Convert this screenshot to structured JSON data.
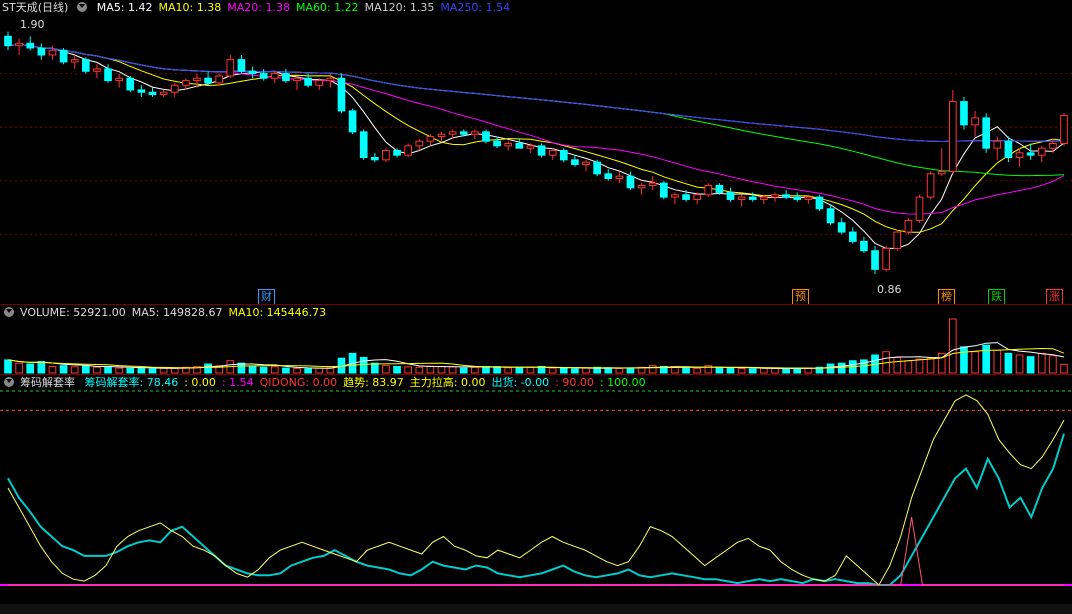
{
  "colors": {
    "ma5": "#ffffff",
    "ma10": "#ffff00",
    "ma20": "#ff00ff",
    "ma60": "#00ff00",
    "ma120": "#cccccc",
    "ma250": "#3344ff",
    "up": "#ff3333",
    "down": "#00ffff",
    "grid": "#7a0000"
  },
  "price_panel": {
    "title": "ST天成(日线)",
    "ma_labels": [
      {
        "name": "MA5",
        "value": "1.42",
        "color": "#ffffff"
      },
      {
        "name": "MA10",
        "value": "1.38",
        "color": "#ffff00"
      },
      {
        "name": "MA20",
        "value": "1.38",
        "color": "#ff00ff"
      },
      {
        "name": "MA60",
        "value": "1.22",
        "color": "#00ff00"
      },
      {
        "name": "MA120",
        "value": "1.35",
        "color": "#cccccc"
      },
      {
        "name": "MA250",
        "value": "1.54",
        "color": "#3344ff"
      }
    ],
    "high_label": "1.90",
    "low_label": "0.86",
    "tags": [
      {
        "text": "财",
        "color": "#3399ff"
      },
      {
        "text": "预",
        "color": "#ff8800"
      },
      {
        "text": "榜",
        "color": "#ff8800"
      },
      {
        "text": "跌",
        "color": "#00cc00"
      },
      {
        "text": "涨",
        "color": "#ff3333"
      }
    ]
  },
  "volume_panel": {
    "labels": [
      {
        "name": "VOLUME",
        "value": "52921.00",
        "color": "#dddddd"
      },
      {
        "name": "MA5",
        "value": "149828.67",
        "color": "#dddddd"
      },
      {
        "name": "MA10",
        "value": "145446.73",
        "color": "#ffff00"
      }
    ]
  },
  "indicator_panel": {
    "title": "筹码解套率",
    "labels": [
      {
        "text": "筹码解套率: 78.46",
        "color": "#00ffff"
      },
      {
        "text": ": 0.00",
        "color": "#ffff00"
      },
      {
        "text": ": 1.54",
        "color": "#ff00ff"
      },
      {
        "text": "QIDONG: 0.00",
        "color": "#ff3333"
      },
      {
        "text": "趋势: 83.97",
        "color": "#ffff00"
      },
      {
        "text": "主力拉高: 0.00",
        "color": "#ffff00"
      },
      {
        "text": "出货: -0.00",
        "color": "#00ffff"
      },
      {
        "text": ": 90.00",
        "color": "#ff3333"
      },
      {
        "text": ": 100.00",
        "color": "#00ff00"
      }
    ]
  },
  "chart_data": [
    {
      "type": "candlestick",
      "ylim": [
        0.8,
        1.95
      ],
      "ohlc": [
        [
          1.88,
          1.9,
          1.82,
          1.84
        ],
        [
          1.84,
          1.87,
          1.8,
          1.85
        ],
        [
          1.85,
          1.88,
          1.82,
          1.83
        ],
        [
          1.83,
          1.85,
          1.78,
          1.8
        ],
        [
          1.8,
          1.84,
          1.78,
          1.82
        ],
        [
          1.82,
          1.83,
          1.76,
          1.77
        ],
        [
          1.77,
          1.8,
          1.74,
          1.78
        ],
        [
          1.78,
          1.79,
          1.72,
          1.73
        ],
        [
          1.73,
          1.76,
          1.7,
          1.74
        ],
        [
          1.74,
          1.76,
          1.68,
          1.69
        ],
        [
          1.69,
          1.72,
          1.66,
          1.7
        ],
        [
          1.7,
          1.71,
          1.64,
          1.65
        ],
        [
          1.65,
          1.67,
          1.62,
          1.64
        ],
        [
          1.64,
          1.66,
          1.62,
          1.63
        ],
        [
          1.63,
          1.65,
          1.62,
          1.64
        ],
        [
          1.64,
          1.68,
          1.62,
          1.67
        ],
        [
          1.67,
          1.7,
          1.65,
          1.69
        ],
        [
          1.69,
          1.72,
          1.66,
          1.7
        ],
        [
          1.7,
          1.73,
          1.67,
          1.68
        ],
        [
          1.68,
          1.72,
          1.67,
          1.71
        ],
        [
          1.71,
          1.8,
          1.7,
          1.78
        ],
        [
          1.78,
          1.8,
          1.72,
          1.73
        ],
        [
          1.73,
          1.75,
          1.7,
          1.72
        ],
        [
          1.72,
          1.74,
          1.69,
          1.7
        ],
        [
          1.7,
          1.73,
          1.68,
          1.72
        ],
        [
          1.72,
          1.74,
          1.68,
          1.69
        ],
        [
          1.69,
          1.71,
          1.65,
          1.7
        ],
        [
          1.7,
          1.72,
          1.66,
          1.67
        ],
        [
          1.67,
          1.7,
          1.65,
          1.69
        ],
        [
          1.69,
          1.72,
          1.66,
          1.7
        ],
        [
          1.7,
          1.72,
          1.55,
          1.56
        ],
        [
          1.56,
          1.57,
          1.46,
          1.47
        ],
        [
          1.47,
          1.48,
          1.35,
          1.36
        ],
        [
          1.36,
          1.38,
          1.34,
          1.35
        ],
        [
          1.35,
          1.4,
          1.34,
          1.39
        ],
        [
          1.39,
          1.4,
          1.36,
          1.37
        ],
        [
          1.37,
          1.42,
          1.36,
          1.41
        ],
        [
          1.41,
          1.44,
          1.39,
          1.43
        ],
        [
          1.43,
          1.46,
          1.41,
          1.45
        ],
        [
          1.45,
          1.47,
          1.43,
          1.46
        ],
        [
          1.46,
          1.48,
          1.44,
          1.47
        ],
        [
          1.47,
          1.48,
          1.45,
          1.46
        ],
        [
          1.46,
          1.48,
          1.44,
          1.47
        ],
        [
          1.47,
          1.48,
          1.42,
          1.43
        ],
        [
          1.43,
          1.45,
          1.4,
          1.41
        ],
        [
          1.41,
          1.43,
          1.39,
          1.42
        ],
        [
          1.42,
          1.44,
          1.4,
          1.4
        ],
        [
          1.4,
          1.42,
          1.38,
          1.41
        ],
        [
          1.41,
          1.42,
          1.36,
          1.37
        ],
        [
          1.37,
          1.4,
          1.35,
          1.39
        ],
        [
          1.39,
          1.4,
          1.34,
          1.35
        ],
        [
          1.35,
          1.37,
          1.32,
          1.33
        ],
        [
          1.33,
          1.35,
          1.3,
          1.34
        ],
        [
          1.34,
          1.35,
          1.28,
          1.29
        ],
        [
          1.29,
          1.31,
          1.26,
          1.27
        ],
        [
          1.27,
          1.3,
          1.25,
          1.28
        ],
        [
          1.28,
          1.3,
          1.22,
          1.23
        ],
        [
          1.23,
          1.25,
          1.2,
          1.24
        ],
        [
          1.24,
          1.28,
          1.22,
          1.25
        ],
        [
          1.25,
          1.26,
          1.18,
          1.19
        ],
        [
          1.19,
          1.21,
          1.16,
          1.2
        ],
        [
          1.2,
          1.22,
          1.17,
          1.18
        ],
        [
          1.18,
          1.21,
          1.16,
          1.2
        ],
        [
          1.2,
          1.25,
          1.19,
          1.24
        ],
        [
          1.24,
          1.25,
          1.2,
          1.21
        ],
        [
          1.21,
          1.23,
          1.17,
          1.18
        ],
        [
          1.18,
          1.2,
          1.15,
          1.19
        ],
        [
          1.19,
          1.21,
          1.17,
          1.18
        ],
        [
          1.18,
          1.2,
          1.16,
          1.19
        ],
        [
          1.19,
          1.21,
          1.17,
          1.2
        ],
        [
          1.2,
          1.22,
          1.18,
          1.19
        ],
        [
          1.19,
          1.21,
          1.17,
          1.18
        ],
        [
          1.18,
          1.2,
          1.16,
          1.19
        ],
        [
          1.19,
          1.2,
          1.13,
          1.14
        ],
        [
          1.14,
          1.16,
          1.07,
          1.08
        ],
        [
          1.08,
          1.1,
          1.03,
          1.04
        ],
        [
          1.04,
          1.06,
          0.99,
          1.0
        ],
        [
          1.0,
          1.02,
          0.95,
          0.96
        ],
        [
          0.96,
          0.98,
          0.86,
          0.88
        ],
        [
          0.88,
          0.98,
          0.87,
          0.97
        ],
        [
          0.97,
          1.05,
          0.96,
          1.04
        ],
        [
          1.04,
          1.1,
          1.03,
          1.09
        ],
        [
          1.09,
          1.2,
          1.08,
          1.19
        ],
        [
          1.19,
          1.3,
          1.18,
          1.29
        ],
        [
          1.29,
          1.4,
          1.28,
          1.3
        ],
        [
          1.3,
          1.65,
          1.29,
          1.6
        ],
        [
          1.6,
          1.62,
          1.48,
          1.5
        ],
        [
          1.5,
          1.56,
          1.45,
          1.53
        ],
        [
          1.53,
          1.55,
          1.38,
          1.4
        ],
        [
          1.4,
          1.45,
          1.35,
          1.43
        ],
        [
          1.43,
          1.45,
          1.34,
          1.36
        ],
        [
          1.36,
          1.4,
          1.32,
          1.38
        ],
        [
          1.38,
          1.42,
          1.35,
          1.37
        ],
        [
          1.37,
          1.41,
          1.34,
          1.4
        ],
        [
          1.4,
          1.44,
          1.38,
          1.42
        ],
        [
          1.42,
          1.55,
          1.41,
          1.54
        ]
      ]
    },
    {
      "type": "bar",
      "title": "VOLUME",
      "values": [
        80,
        60,
        55,
        70,
        40,
        45,
        38,
        42,
        35,
        40,
        30,
        28,
        32,
        25,
        30,
        28,
        35,
        40,
        55,
        45,
        75,
        60,
        40,
        35,
        38,
        30,
        28,
        25,
        30,
        32,
        90,
        120,
        95,
        60,
        45,
        40,
        38,
        35,
        42,
        40,
        38,
        30,
        35,
        40,
        38,
        32,
        30,
        35,
        40,
        30,
        28,
        25,
        30,
        35,
        32,
        28,
        30,
        35,
        45,
        40,
        38,
        30,
        28,
        45,
        35,
        30,
        28,
        25,
        30,
        28,
        25,
        30,
        28,
        35,
        55,
        60,
        75,
        80,
        110,
        130,
        95,
        75,
        85,
        90,
        120,
        330,
        160,
        130,
        170,
        140,
        120,
        110,
        100,
        120,
        105,
        53
      ]
    },
    {
      "type": "line",
      "title": "筹码解套率",
      "ylim": [
        0,
        100
      ],
      "series": [
        {
          "name": "筹码解套率",
          "color": "#00cccc",
          "values": [
            55,
            45,
            38,
            30,
            25,
            20,
            18,
            15,
            15,
            15,
            17,
            20,
            22,
            23,
            22,
            28,
            30,
            25,
            20,
            15,
            10,
            8,
            6,
            5,
            5,
            6,
            10,
            12,
            14,
            15,
            18,
            15,
            12,
            10,
            9,
            8,
            6,
            5,
            8,
            12,
            10,
            9,
            8,
            10,
            9,
            6,
            5,
            4,
            5,
            6,
            8,
            10,
            7,
            5,
            4,
            5,
            6,
            8,
            5,
            4,
            5,
            6,
            5,
            4,
            3,
            3,
            2,
            1,
            2,
            3,
            2,
            3,
            2,
            1,
            3,
            2,
            3,
            2,
            1,
            1,
            0,
            0,
            5,
            15,
            25,
            35,
            45,
            55,
            60,
            50,
            65,
            55,
            40,
            45,
            35,
            50,
            60,
            78
          ]
        },
        {
          "name": "趋势",
          "color": "#ffff66",
          "values": [
            50,
            40,
            30,
            20,
            12,
            6,
            3,
            2,
            5,
            10,
            20,
            25,
            28,
            30,
            32,
            28,
            25,
            20,
            18,
            15,
            10,
            6,
            4,
            8,
            14,
            18,
            20,
            22,
            20,
            18,
            16,
            14,
            12,
            18,
            20,
            22,
            20,
            18,
            16,
            22,
            25,
            20,
            18,
            15,
            14,
            18,
            16,
            14,
            18,
            22,
            25,
            22,
            20,
            18,
            15,
            12,
            10,
            12,
            20,
            30,
            28,
            25,
            20,
            15,
            10,
            14,
            18,
            22,
            24,
            20,
            18,
            12,
            8,
            5,
            3,
            2,
            5,
            15,
            10,
            5,
            0,
            10,
            25,
            45,
            60,
            75,
            85,
            95,
            98,
            95,
            88,
            75,
            68,
            62,
            60,
            66,
            75,
            85
          ]
        },
        {
          "name": "主力拉高",
          "color": "#ff5577",
          "values": [
            0,
            0,
            0,
            0,
            0,
            0,
            0,
            0,
            0,
            0,
            0,
            0,
            0,
            0,
            0,
            0,
            0,
            0,
            0,
            0,
            0,
            0,
            0,
            0,
            0,
            0,
            0,
            0,
            0,
            0,
            0,
            0,
            0,
            0,
            0,
            0,
            0,
            0,
            0,
            0,
            0,
            0,
            0,
            0,
            0,
            0,
            0,
            0,
            0,
            0,
            0,
            0,
            0,
            0,
            0,
            0,
            0,
            0,
            0,
            0,
            0,
            0,
            0,
            0,
            0,
            0,
            0,
            0,
            0,
            0,
            0,
            0,
            0,
            0,
            0,
            0,
            0,
            0,
            0,
            0,
            0,
            0,
            0,
            35,
            0,
            0,
            0,
            0,
            0,
            0,
            0,
            0,
            0,
            0,
            0,
            0,
            0,
            0
          ]
        }
      ],
      "reference_lines": [
        90,
        100
      ]
    }
  ]
}
